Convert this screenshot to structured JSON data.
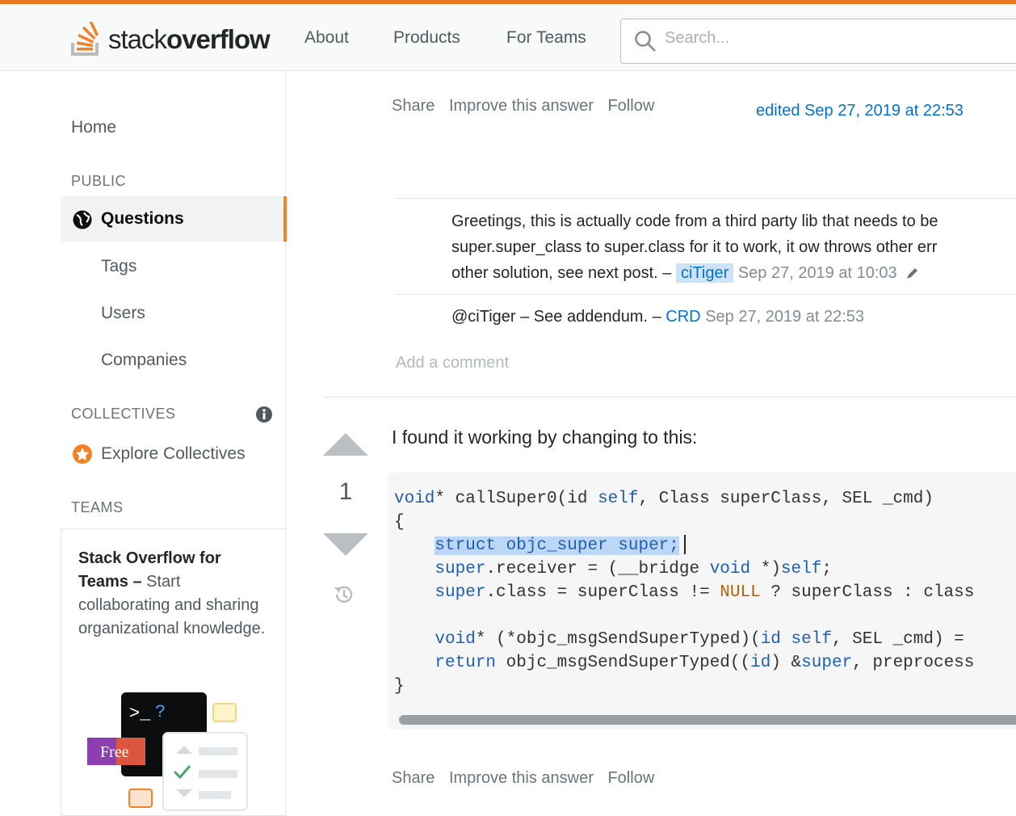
{
  "header": {
    "logo_plain": "stack",
    "logo_bold": "overflow",
    "nav": [
      "About",
      "Products",
      "For Teams"
    ],
    "search_placeholder": "Search..."
  },
  "sidebar": {
    "home": "Home",
    "public_label": "PUBLIC",
    "questions": "Questions",
    "items": [
      "Tags",
      "Users",
      "Companies"
    ],
    "collectives_label": "COLLECTIVES",
    "explore_collectives": "Explore Collectives",
    "teams_label": "TEAMS",
    "teams_promo_title": "Stack Overflow for Teams",
    "teams_promo_dash": " – ",
    "teams_promo_body": "Start collaborating and sharing organizational knowledge.",
    "free_badge": "Free",
    "terminal_prompt": ">_?"
  },
  "post_top": {
    "share": "Share",
    "improve": "Improve this answer",
    "follow": "Follow",
    "edited": "edited Sep 27, 2019 at 22:53"
  },
  "comments": [
    {
      "lines": [
        "Greetings, this is actually code from a third party lib that needs to be",
        "super.super_class to super.class for it to work, it ow throws other err"
      ],
      "last_line": "other solution, see next post. –",
      "user": "ciTiger",
      "date": "Sep 27, 2019 at 10:03"
    },
    {
      "text": "@ciTiger – See addendum. –",
      "user": "CRD",
      "date": "Sep 27, 2019 at 22:53"
    }
  ],
  "add_comment": "Add a comment",
  "answer": {
    "votes": "1",
    "text": "I found it working by changing to this:",
    "code": {
      "l1_a": "void",
      "l1_b": "* callSuper0(id ",
      "l1_c": "self",
      "l1_d": ", Class superClass, SEL _cmd)",
      "l2": "{",
      "l3_sel": "struct objc_super super;",
      "l4_a": "super",
      "l4_b": ".receiver = (__bridge ",
      "l4_c": "void",
      "l4_d": " *)",
      "l4_e": "self",
      "l4_f": ";",
      "l5_a": "super",
      "l5_b": ".class = superClass != ",
      "l5_c": "NULL",
      "l5_d": " ? superClass : class",
      "l7_a": "void",
      "l7_b": "* (*objc_msgSendSuperTyped)(",
      "l7_c": "id",
      "l7_d": " ",
      "l7_e": "self",
      "l7_f": ", SEL _cmd) = ",
      "l8_a": "return",
      "l8_b": " objc_msgSendSuperTyped((",
      "l8_c": "id",
      "l8_d": ") &",
      "l8_e": "super",
      "l8_f": ", preprocess",
      "l9": "}"
    }
  },
  "post_bottom": {
    "share": "Share",
    "improve": "Improve this answer",
    "follow": "Follow"
  },
  "colors": {
    "accent": "#f48225",
    "link": "#0074cc",
    "keyword": "#1f5fb3"
  }
}
